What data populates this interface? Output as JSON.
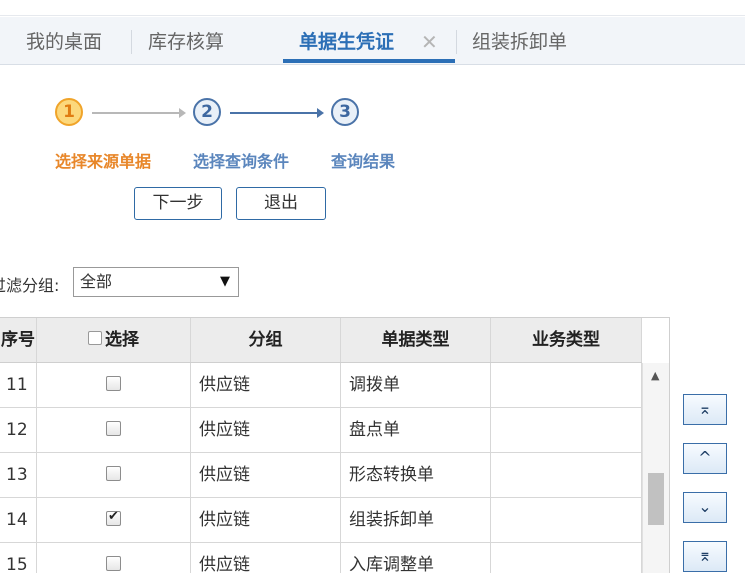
{
  "tabs": [
    {
      "label": "我的桌面"
    },
    {
      "label": "库存核算"
    },
    {
      "label": "单据生凭证",
      "active": true,
      "close_glyph": "✕"
    },
    {
      "label": "组装拆卸单"
    }
  ],
  "steps": [
    {
      "number": "1",
      "label": "选择来源单据",
      "state": "current"
    },
    {
      "number": "2",
      "label": "选择查询条件",
      "state": "pending"
    },
    {
      "number": "3",
      "label": "查询结果",
      "state": "pending"
    }
  ],
  "buttons": {
    "next": "下一步",
    "exit": "退出"
  },
  "filter": {
    "label": "过滤分组:",
    "value": "全部",
    "caret": "▼"
  },
  "table": {
    "headers": {
      "seq": "序号",
      "select": "选择",
      "group": "分组",
      "doc_type": "单据类型",
      "biz_type": "业务类型"
    },
    "rows": [
      {
        "seq": "11",
        "checked": false,
        "group": "供应链",
        "doc_type": "调拨单",
        "biz_type": ""
      },
      {
        "seq": "12",
        "checked": false,
        "group": "供应链",
        "doc_type": "盘点单",
        "biz_type": ""
      },
      {
        "seq": "13",
        "checked": false,
        "group": "供应链",
        "doc_type": "形态转换单",
        "biz_type": ""
      },
      {
        "seq": "14",
        "checked": true,
        "group": "供应链",
        "doc_type": "组装拆卸单",
        "biz_type": ""
      },
      {
        "seq": "15",
        "checked": false,
        "group": "供应链",
        "doc_type": "入库调整单",
        "biz_type": ""
      }
    ]
  },
  "move_buttons": [
    {
      "name": "move-top-button",
      "glyph": "⌅"
    },
    {
      "name": "move-up-button",
      "glyph": "^"
    },
    {
      "name": "move-down-button",
      "glyph": "⌄"
    },
    {
      "name": "move-bottom-button",
      "glyph": "⌆"
    }
  ],
  "colors": {
    "accent": "#2c6fb6",
    "step_current": "#e8872a",
    "step_pending": "#5b86bd"
  }
}
